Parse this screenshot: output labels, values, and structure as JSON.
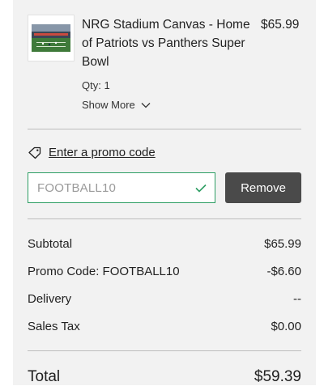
{
  "item": {
    "name": "NRG Stadium Canvas - Home of Patriots vs Panthers Super Bowl",
    "price": "$65.99",
    "qty": "Qty: 1",
    "show_more": "Show More",
    "thumbnail_icon": "stadium-image"
  },
  "promo": {
    "link_label": "Enter a promo code",
    "code_value": "FOOTBALL10",
    "remove_label": "Remove",
    "accent_color": "#2e9e64"
  },
  "summary": {
    "subtotal_label": "Subtotal",
    "subtotal_value": "$65.99",
    "promo_label": "Promo Code: FOOTBALL10",
    "promo_value": "-$6.60",
    "delivery_label": "Delivery",
    "delivery_value": "--",
    "tax_label": "Sales Tax",
    "tax_value": "$0.00",
    "total_label": "Total",
    "total_value": "$59.39"
  }
}
